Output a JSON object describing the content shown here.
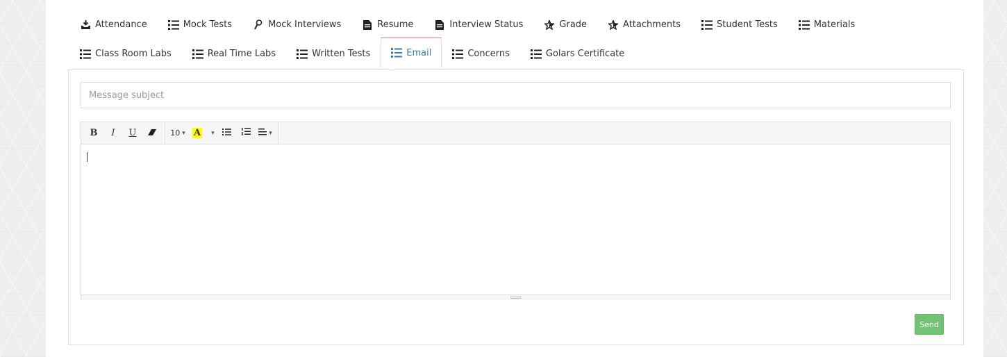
{
  "tabs": {
    "row1": [
      {
        "label": "Attendance",
        "icon": "download-tray-icon"
      },
      {
        "label": "Mock Tests",
        "icon": "list-icon"
      },
      {
        "label": "Mock Interviews",
        "icon": "magnifier-icon"
      },
      {
        "label": "Resume",
        "icon": "document-icon"
      },
      {
        "label": "Interview Status",
        "icon": "document-icon"
      },
      {
        "label": "Grade",
        "icon": "star-icon"
      },
      {
        "label": "Attachments",
        "icon": "star-icon"
      },
      {
        "label": "Student Tests",
        "icon": "list-icon"
      },
      {
        "label": "Materials",
        "icon": "list-icon"
      }
    ],
    "row2": [
      {
        "label": "Class Room Labs",
        "icon": "list-icon"
      },
      {
        "label": "Real Time Labs",
        "icon": "list-icon"
      },
      {
        "label": "Written Tests",
        "icon": "list-icon"
      },
      {
        "label": "Email",
        "icon": "list-icon",
        "active": true
      },
      {
        "label": "Concerns",
        "icon": "list-icon"
      },
      {
        "label": "Golars Certificate",
        "icon": "list-icon"
      }
    ]
  },
  "email": {
    "subject_placeholder": "Message subject",
    "subject_value": "",
    "toolbar": {
      "bold": "B",
      "italic": "I",
      "underline": "U",
      "font_size": "10",
      "highlight": "A"
    },
    "body_value": "",
    "send_label": "Send"
  },
  "colors": {
    "active_tab_text": "#337ab7",
    "active_tab_top": "#e07a6b",
    "send_button": "#5cb85c"
  }
}
